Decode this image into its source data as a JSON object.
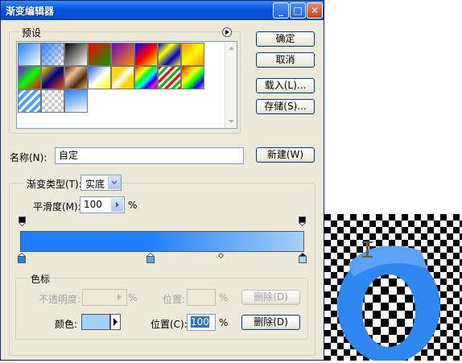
{
  "window": {
    "title": "渐变编辑器",
    "controls": {
      "minimize": "_",
      "maximize": "□",
      "close": "✕"
    }
  },
  "presets": {
    "label": "预设",
    "menu_icon": "arrow-circle-icon",
    "swatches": [
      {
        "kind": "gradient",
        "css": "linear-gradient(135deg,#1f7fff,#ffffff)"
      },
      {
        "kind": "checker-gradient",
        "css": "linear-gradient(135deg,rgba(30,120,255,0.9),rgba(30,120,255,0))"
      },
      {
        "kind": "gradient",
        "css": "linear-gradient(135deg,#000000,#ffffff)"
      },
      {
        "kind": "gradient",
        "css": "linear-gradient(135deg,#ff0000,#00a000)"
      },
      {
        "kind": "gradient",
        "css": "linear-gradient(135deg,#6a00c8,#ff8c00)"
      },
      {
        "kind": "gradient",
        "css": "linear-gradient(135deg,#0000ff,#ff0000,#ffff00)"
      },
      {
        "kind": "gradient",
        "css": "linear-gradient(135deg,#0000c8,#ffff00,#0000c8,#ffff00)"
      },
      {
        "kind": "gradient",
        "css": "linear-gradient(135deg,#ff8c00,#ffff00,#ff8c00)"
      },
      {
        "kind": "gradient",
        "css": "linear-gradient(135deg,#8b00ff,#00ff00,#ff0000)"
      },
      {
        "kind": "gradient",
        "css": "linear-gradient(135deg,#ffd700,#000080,#ff4500)"
      },
      {
        "kind": "gradient",
        "css": "linear-gradient(135deg,#4a2a10,#f0c090,#4a2a10,#e0b080)"
      },
      {
        "kind": "gradient",
        "css": "linear-gradient(135deg,#2060ff,#ffffff,#ffff00)"
      },
      {
        "kind": "gradient",
        "css": "linear-gradient(135deg,#ffd700 30%,#ffffff,#ffd700 70%)"
      },
      {
        "kind": "gradient",
        "css": "linear-gradient(135deg,red,orange,yellow,lime,cyan,blue,magenta,red)"
      },
      {
        "kind": "gradient",
        "css": "repeating-linear-gradient(135deg,#ff0000 0 3px,#ffffff 3px 6px,#00c000 6px 9px,#ffffff 9px 12px)"
      },
      {
        "kind": "gradient",
        "css": "linear-gradient(135deg,red,orange,yellow,lime,blue,violet)"
      },
      {
        "kind": "gradient",
        "css": "repeating-linear-gradient(135deg,#4aa0ff 0 4px,#ffffff 4px 7px)"
      },
      {
        "kind": "checker",
        "css": ""
      },
      {
        "kind": "gradient",
        "css": "linear-gradient(160deg,#1f7fff,#ffffff)"
      }
    ]
  },
  "buttons": {
    "ok": "确定",
    "cancel": "取消",
    "load": "载入(L)...",
    "save": "存储(S)...",
    "new": "新建(W)"
  },
  "name": {
    "label": "名称(N):",
    "value": "自定"
  },
  "gradient_type": {
    "label": "渐变类型(T):",
    "value": "实底"
  },
  "smoothness": {
    "label": "平滑度(M):",
    "value": "100",
    "unit": "%"
  },
  "gradient_bar": {
    "start_color": "#1f7fff",
    "end_color": "#a6d0f6"
  },
  "stops": {
    "label": "色标",
    "opacity_label": "不透明度:",
    "opacity_unit": "%",
    "opacity_location_label": "位置:",
    "opacity_location_unit": "%",
    "delete_disabled": "删除(D)",
    "color_label": "颜色:",
    "color_value": "#a6d0f6",
    "location_label": "位置(C):",
    "location_value": "100",
    "location_unit": "%",
    "delete": "删除(D)"
  }
}
